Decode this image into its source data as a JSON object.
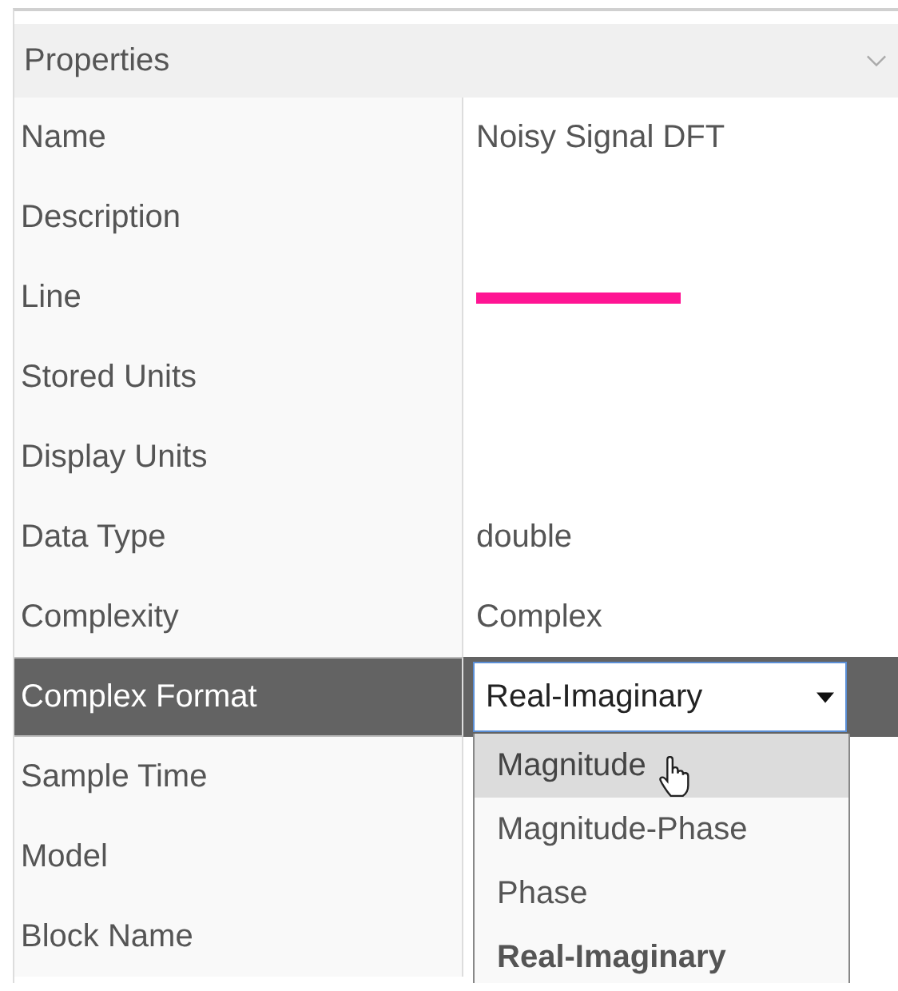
{
  "panel": {
    "title": "Properties",
    "expanded": true
  },
  "rows": [
    {
      "label": "Name",
      "kind": "text",
      "value": "Noisy Signal DFT",
      "selected": false
    },
    {
      "label": "Description",
      "kind": "text",
      "selected": false
    },
    {
      "label": "Line",
      "kind": "line",
      "color": "#ff1493",
      "selected": false
    },
    {
      "label": "Stored Units",
      "kind": "text",
      "selected": false
    },
    {
      "label": "Display Units",
      "kind": "text",
      "selected": false
    },
    {
      "label": "Data Type",
      "kind": "text",
      "value": "double",
      "selected": false
    },
    {
      "label": "Complexity",
      "kind": "text",
      "value": "Complex",
      "selected": false
    },
    {
      "label": "Complex Format",
      "kind": "select",
      "value": "Real-Imaginary",
      "expanded": true,
      "selected": true,
      "options": [
        {
          "label": "Magnitude",
          "hovered": true,
          "selected": false
        },
        {
          "label": "Magnitude-Phase",
          "hovered": false,
          "selected": false
        },
        {
          "label": "Phase",
          "hovered": false,
          "selected": false
        },
        {
          "label": "Real-Imaginary",
          "hovered": false,
          "selected": true
        }
      ]
    },
    {
      "label": "Sample Time",
      "kind": "text",
      "selected": false
    },
    {
      "label": "Model",
      "kind": "text",
      "selected": false
    },
    {
      "label": "Block Name",
      "kind": "text",
      "selected": false
    }
  ]
}
